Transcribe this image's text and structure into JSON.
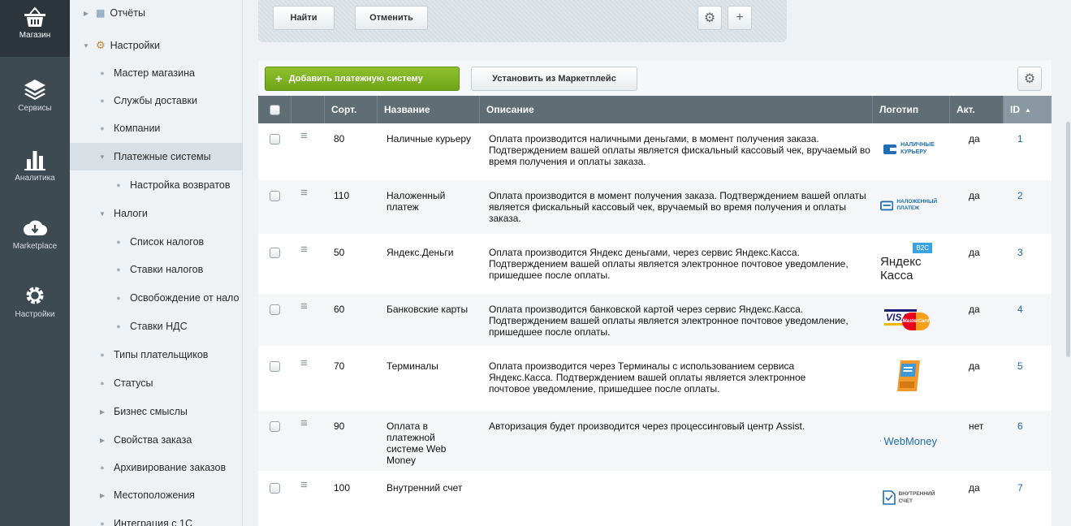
{
  "rail": {
    "items": [
      {
        "label": "Магазин",
        "icon": "basket-icon"
      },
      {
        "label": "Сервисы",
        "icon": "layers-icon"
      },
      {
        "label": "Аналитика",
        "icon": "bar-chart-icon"
      },
      {
        "label": "Marketplace",
        "icon": "cloud-download-icon"
      },
      {
        "label": "Настройки",
        "icon": "gear-icon"
      }
    ]
  },
  "tree": {
    "items": [
      {
        "label": "Отчёты",
        "type": "expandable"
      },
      {
        "label": "Настройки",
        "type": "expanded"
      },
      {
        "label": "Мастер магазина",
        "type": "leaf"
      },
      {
        "label": "Службы доставки",
        "type": "leaf"
      },
      {
        "label": "Компании",
        "type": "leaf"
      },
      {
        "label": "Платежные системы",
        "type": "expanded"
      },
      {
        "label": "Настройка возвратов",
        "type": "leaf"
      },
      {
        "label": "Налоги",
        "type": "expanded"
      },
      {
        "label": "Список налогов",
        "type": "leaf"
      },
      {
        "label": "Ставки налогов",
        "type": "leaf"
      },
      {
        "label": "Освобождение от нало",
        "type": "leaf"
      },
      {
        "label": "Ставки НДС",
        "type": "leaf"
      },
      {
        "label": "Типы плательщиков",
        "type": "leaf"
      },
      {
        "label": "Статусы",
        "type": "leaf"
      },
      {
        "label": "Бизнес смыслы",
        "type": "expandable"
      },
      {
        "label": "Свойства заказа",
        "type": "expandable"
      },
      {
        "label": "Архивирование заказов",
        "type": "leaf"
      },
      {
        "label": "Местоположения",
        "type": "expandable"
      },
      {
        "label": "Интеграция с 1С",
        "type": "leaf"
      }
    ]
  },
  "filter": {
    "find_label": "Найти",
    "cancel_label": "Отменить"
  },
  "toolbar": {
    "add_label": "Добавить платежную систему",
    "marketplace_label": "Установить из Маркетплейс"
  },
  "table": {
    "headers": {
      "sort": "Сорт.",
      "name": "Название",
      "description": "Описание",
      "logo": "Логотип",
      "active": "Акт.",
      "id": "ID"
    },
    "rows": [
      {
        "sort": "80",
        "name": "Наличные курьеру",
        "description": "Оплата производится наличными деньгами, в момент получения заказа. Подтверждением вашей оплаты является фискальный кассовый чек, вручаемый во время получения и оплаты заказа.",
        "logo_text_1": "НАЛИЧНЫЕ",
        "logo_text_2": "КУРЬЕРУ",
        "active": "да",
        "id": "1"
      },
      {
        "sort": "110",
        "name": "Наложенный платеж",
        "description": "Оплата производится в момент получения заказа. Подтверждением вашей оплаты является фискальный кассовый чек, вручаемый во время получения и оплаты заказа.",
        "logo_text_1": "НАЛОЖЕННЫЙ",
        "logo_text_2": "ПЛАТЕЖ",
        "active": "да",
        "id": "2"
      },
      {
        "sort": "50",
        "name": "Яндекс.Деньги",
        "description": "Оплата производится Яндекс деньгами, через сервис Яндекс.Касса. Подтверждением вашей оплаты является электронное почтовое уведомление, пришедшее после оплаты.",
        "logo_text_1": "B2C",
        "logo_text_2": "Яндекс Касса",
        "active": "да",
        "id": "3"
      },
      {
        "sort": "60",
        "name": "Банковские карты",
        "description": "Оплата производится банковской картой через сервис Яндекс.Касса. Подтверждением вашей оплаты является электронное почтовое уведомление, пришедшее после оплаты.",
        "logo_text_1": "VISA",
        "logo_text_2": "MasterCard",
        "active": "да",
        "id": "4"
      },
      {
        "sort": "70",
        "name": "Терминалы",
        "description": "Оплата производится через Терминалы с использованием сервиса Яндекс.Касса. Подтверждением вашей оплаты является электронное почтовое уведомление, пришедшее после оплаты.",
        "logo_text_1": "",
        "logo_text_2": "",
        "active": "да",
        "id": "5"
      },
      {
        "sort": "90",
        "name": "Оплата в платежной системе Web Money",
        "description": "Авторизация будет производится через процессинговый центр Assist.",
        "logo_text_1": "WebMoney",
        "logo_text_2": "",
        "active": "нет",
        "id": "6"
      },
      {
        "sort": "100",
        "name": "Внутренний счет",
        "description": "",
        "logo_text_1": "ВНУТРЕННИЙ",
        "logo_text_2": "СЧЕТ",
        "active": "да",
        "id": "7"
      }
    ]
  },
  "colors": {
    "accent_green": "#7ab122",
    "link_blue": "#2067b0",
    "header_bg": "#5f6d75",
    "rail_bg": "#3e4a52"
  }
}
